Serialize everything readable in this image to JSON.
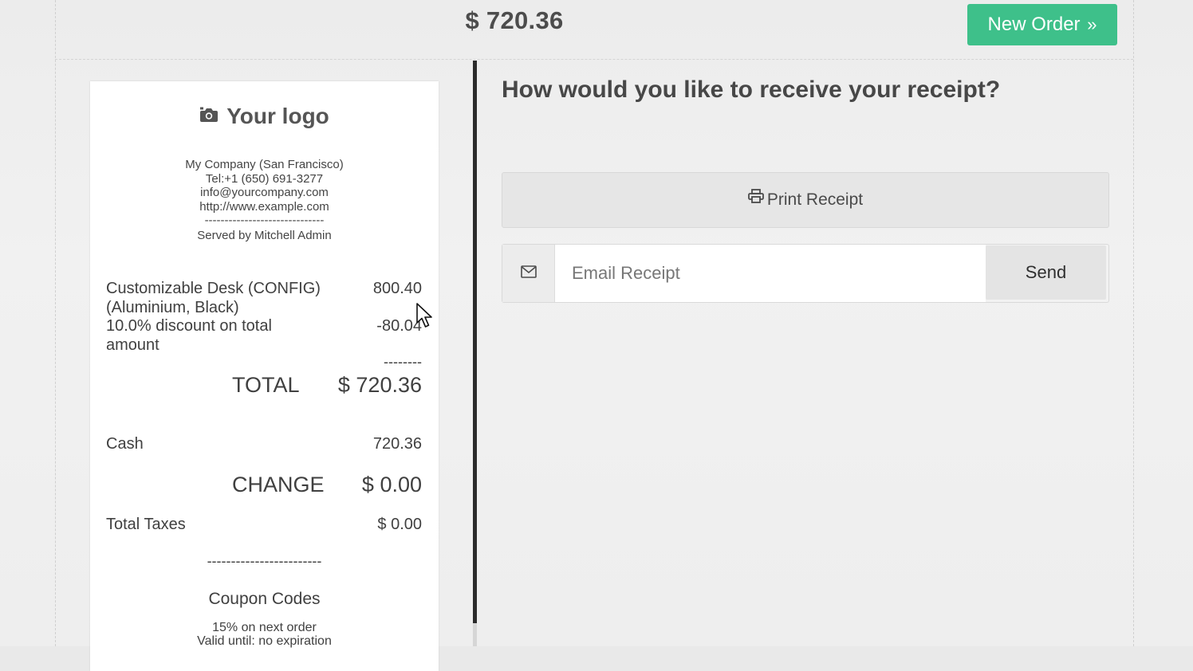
{
  "header": {
    "total": "$ 720.36",
    "new_order_label": "New Order",
    "new_order_chevron": "»"
  },
  "receipt": {
    "logo_text": "Your logo",
    "logo_icon": "camera-icon",
    "company_lines": [
      "My Company (San Francisco)",
      "Tel:+1 (650) 691-3277",
      "info@yourcompany.com",
      "http://www.example.com",
      "------------------------------"
    ],
    "served_by": "Served by Mitchell Admin",
    "lines": [
      {
        "name": "Customizable Desk (CONFIG) (Aluminium, Black)",
        "amount": "800.40"
      },
      {
        "name": "10.0% discount on total amount",
        "amount": "-80.04"
      }
    ],
    "subtotal_dashes": "--------",
    "total_label": "TOTAL",
    "total_value": "$ 720.36",
    "payment_label": "Cash",
    "payment_value": "720.36",
    "change_label": "CHANGE",
    "change_value": "$ 0.00",
    "taxes_label": "Total Taxes",
    "taxes_value": "$ 0.00",
    "footer_dashes": "------------------------",
    "coupon_title": "Coupon Codes",
    "coupon_line1": "15% on next order",
    "coupon_line2": "Valid until: no expiration"
  },
  "receipt_panel": {
    "question": "How would you like to receive your receipt?",
    "print_label": "Print Receipt",
    "print_icon": "printer-icon",
    "email_icon": "envelope-icon",
    "email_value": "",
    "email_placeholder": "Email Receipt",
    "send_label": "Send"
  },
  "colors": {
    "accent_green": "#3ec08a",
    "divider": "#2b2b2b"
  }
}
